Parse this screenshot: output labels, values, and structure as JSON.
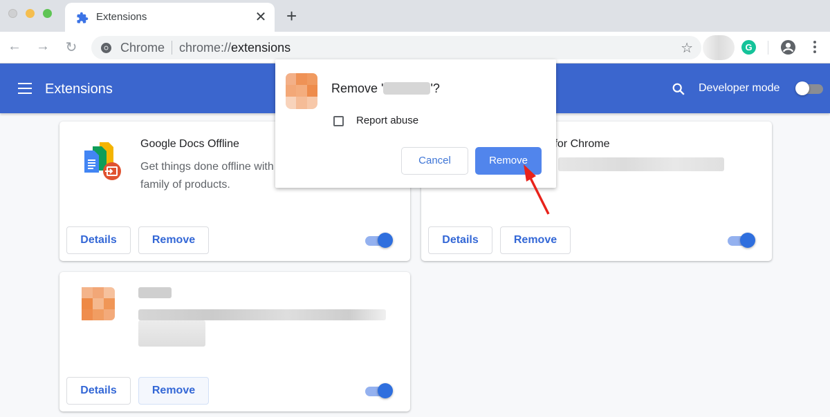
{
  "browser": {
    "tab": {
      "title": "Extensions",
      "icon": "puzzle-icon",
      "close_glyph": "✕"
    },
    "new_tab_glyph": "+",
    "nav": {
      "back": "←",
      "forward": "→",
      "reload": "↻"
    },
    "omnibox": {
      "scheme_label": "Chrome",
      "url_prefix": "chrome://",
      "url_path": "extensions",
      "bookmark_glyph": "☆"
    },
    "extensions_toolbar": {
      "grammarly_letter": "G"
    }
  },
  "page": {
    "title": "Extensions",
    "developer_mode": {
      "label": "Developer mode",
      "enabled": false
    }
  },
  "extensions": [
    {
      "name": "Google Docs Offline",
      "description": "Get things done offline with the Google Docs family of products.",
      "description_visible": "Get things done offline with",
      "description_line2": "family of products.",
      "details_label": "Details",
      "remove_label": "Remove",
      "enabled": true
    },
    {
      "name_visible": "y for Chrome",
      "description_visible": "",
      "details_label": "Details",
      "remove_label": "Remove",
      "enabled": true
    },
    {
      "name_visible": "",
      "description_visible": "",
      "details_label": "Details",
      "remove_label": "Remove",
      "enabled": true
    }
  ],
  "dialog": {
    "title_prefix": "Remove '",
    "title_suffix": "'?",
    "report_abuse_label": "Report abuse",
    "report_abuse_checked": false,
    "cancel_label": "Cancel",
    "remove_label": "Remove"
  },
  "colors": {
    "header_blue": "#3b66ce",
    "accent_blue": "#3367d6",
    "dialog_remove_bg": "#5185ec",
    "annotation_arrow": "#e8231b"
  }
}
